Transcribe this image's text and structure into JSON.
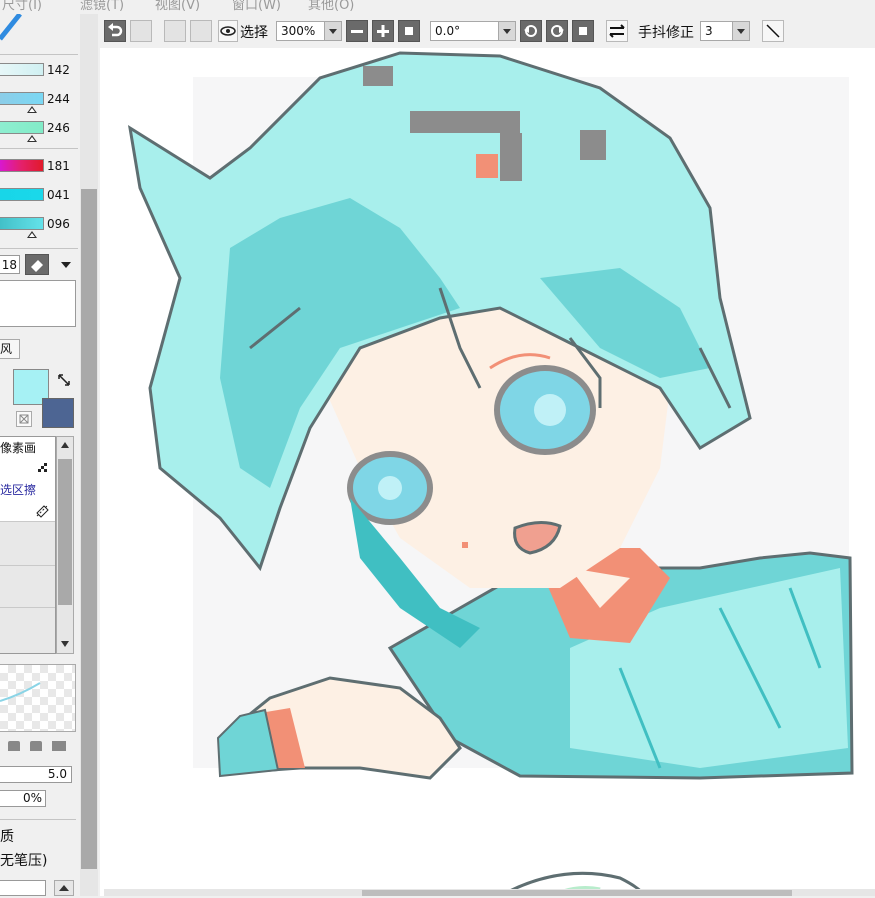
{
  "menubar": {
    "items": [
      "尺寸(I)",
      "滤镜(T)",
      "视图(V)",
      "窗口(W)",
      "其他(O)"
    ]
  },
  "toolbar": {
    "select_label": "选择",
    "zoom_value": "300%",
    "rotation_value": "0.0°",
    "stabilizer_label": "手抖修正",
    "stabilizer_value": "3",
    "icons": [
      "undo-icon",
      "blank-icon",
      "blank-icon",
      "blank-icon",
      "eye-icon",
      "minus-icon",
      "plus-icon",
      "stop-icon",
      "rotate-left-icon",
      "rotate-right-icon",
      "stop-icon",
      "flip-icon",
      "line-icon"
    ]
  },
  "left_panel": {
    "sliders": [
      {
        "value": "142",
        "color": "#c6eef0"
      },
      {
        "value": "244",
        "color": "#7ad8f4"
      },
      {
        "value": "246",
        "color": "#82ecc8"
      },
      {
        "value": "181",
        "color": "#e4206a"
      },
      {
        "value": "041",
        "color": "#1ad8ea"
      },
      {
        "value": "096",
        "color": "#4fd4de"
      }
    ],
    "brush_size": "18",
    "layer_label": "风",
    "primary_color": "#a6f1f4",
    "secondary_color": "#4d6593",
    "tool_items": [
      "像素画",
      "选区擦"
    ],
    "brush_density": "5.0",
    "percent_value": "0%",
    "bottom_label_1": "质",
    "bottom_label_2": "无笔压)"
  },
  "colors": {
    "hair": "#a8efec",
    "hair_shadow": "#6fd5d6",
    "hair_deep": "#40bfc2",
    "skin": "#fdf0e4",
    "outline": "#5e6e71",
    "accent": "#f29076",
    "grey_pixel": "#8c8c8c",
    "eye": "#7fd6e6"
  }
}
